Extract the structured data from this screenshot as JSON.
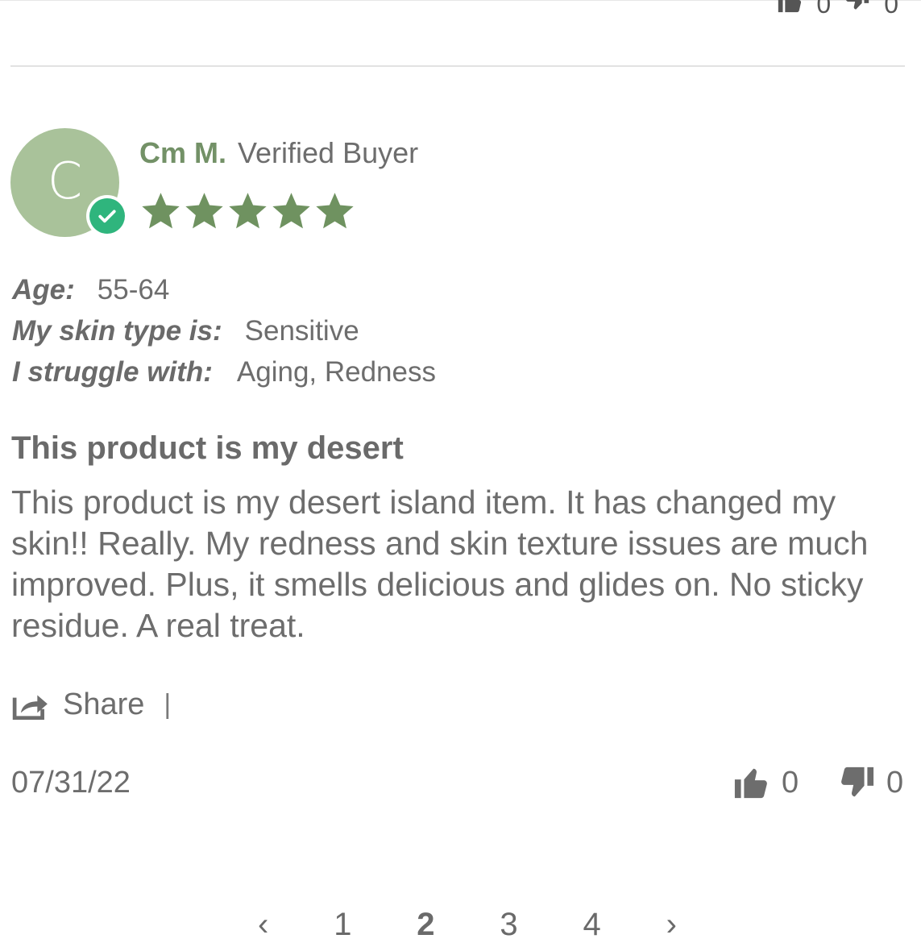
{
  "previous_review": {
    "helpful_count": "0",
    "unhelpful_count": "0"
  },
  "review": {
    "avatar_initial": "C",
    "reviewer_name": "Cm M.",
    "verified_label": "Verified Buyer",
    "rating": 5,
    "rating_max": 5,
    "attributes": [
      {
        "label": "Age:",
        "value": "55-64"
      },
      {
        "label": "My skin type is:",
        "value": "Sensitive"
      },
      {
        "label": "I struggle with:",
        "value": "Aging, Redness"
      }
    ],
    "title": "This product is my desert",
    "body": "This product is my desert island item. It has changed my skin!! Really. My redness and skin texture issues are much improved. Plus, it smells delicious and glides on. No sticky residue. A real treat.",
    "share_label": "Share",
    "share_separator": "|",
    "date": "07/31/22",
    "helpful_count": "0",
    "unhelpful_count": "0"
  },
  "pagination": {
    "prev": "‹",
    "pages": [
      "1",
      "2",
      "3",
      "4"
    ],
    "current": "2",
    "next": "›"
  },
  "colors": {
    "name": "#739167",
    "star": "#6f9260",
    "avatar": "#a9c29a",
    "badge": "#2fb57d",
    "text": "#6d6d6d"
  },
  "icons": [
    "check-icon",
    "star-icon",
    "share-icon",
    "thumbs-up-icon",
    "thumbs-down-icon"
  ]
}
